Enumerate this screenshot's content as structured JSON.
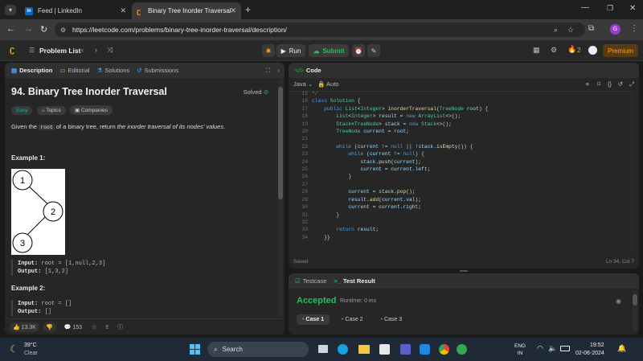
{
  "browser": {
    "tabs": [
      {
        "label": "Feed | LinkedIn",
        "icon": "in"
      },
      {
        "label": "Binary Tree Inorder Traversal - L",
        "icon": "leetcode"
      }
    ],
    "url": "https://leetcode.com/problems/binary-tree-inorder-traversal/description/",
    "profile_initial": "G"
  },
  "nav": {
    "problem_list": "Problem List",
    "run": "Run",
    "submit": "Submit",
    "streak": "2",
    "premium": "Premium"
  },
  "left_tabs": [
    "Description",
    "Editorial",
    "Solutions",
    "Submissions"
  ],
  "problem": {
    "title": "94. Binary Tree Inorder Traversal",
    "status": "Solved",
    "difficulty": "Easy",
    "tag_topics": "Topics",
    "tag_companies": "Companies",
    "desc_pre": "Given the ",
    "desc_code": "root",
    "desc_mid": " of a binary tree, return ",
    "desc_em": "the inorder traversal of its nodes' values",
    "desc_end": ".",
    "ex1_title": "Example 1:",
    "tree_nodes": [
      "1",
      "2",
      "3"
    ],
    "ex1_input_label": "Input:",
    "ex1_input": " root = [1,null,2,3]",
    "ex1_output_label": "Output:",
    "ex1_output": " [1,3,2]",
    "ex2_title": "Example 2:",
    "ex2_input_label": "Input:",
    "ex2_input": " root = []",
    "ex2_output_label": "Output:",
    "ex2_output": " []"
  },
  "bottom_bar": {
    "likes": "13.3K",
    "comments": "153"
  },
  "code_panel": {
    "title": "Code",
    "language": "Java",
    "mode": "Auto",
    "line_numbers": [
      "15",
      "16",
      "17",
      "18",
      "19",
      "20",
      "21",
      "22",
      "23",
      "24",
      "25",
      "26",
      "27",
      "28",
      "29",
      "30",
      "31",
      "32",
      "33",
      "34"
    ],
    "status_left": "Saved",
    "status_right": "Ln 34, Col 7"
  },
  "test_panel": {
    "tab_testcase": "Testcase",
    "tab_result": "Test Result",
    "result": "Accepted",
    "runtime": "Runtime: 0 ms",
    "cases": [
      "Case 1",
      "Case 2",
      "Case 3"
    ]
  },
  "taskbar": {
    "temp": "39°C",
    "weather": "Clear",
    "search": "Search",
    "lang1": "ENG",
    "lang2": "IN",
    "time": "19:52",
    "date": "02-06-2024"
  },
  "colors": {
    "accepted": "#2cbb5d",
    "submit": "#2cbb5d",
    "premium_bg": "#9c5a0e",
    "easy": "#00b8a3",
    "solved": "#2cbb5d"
  }
}
